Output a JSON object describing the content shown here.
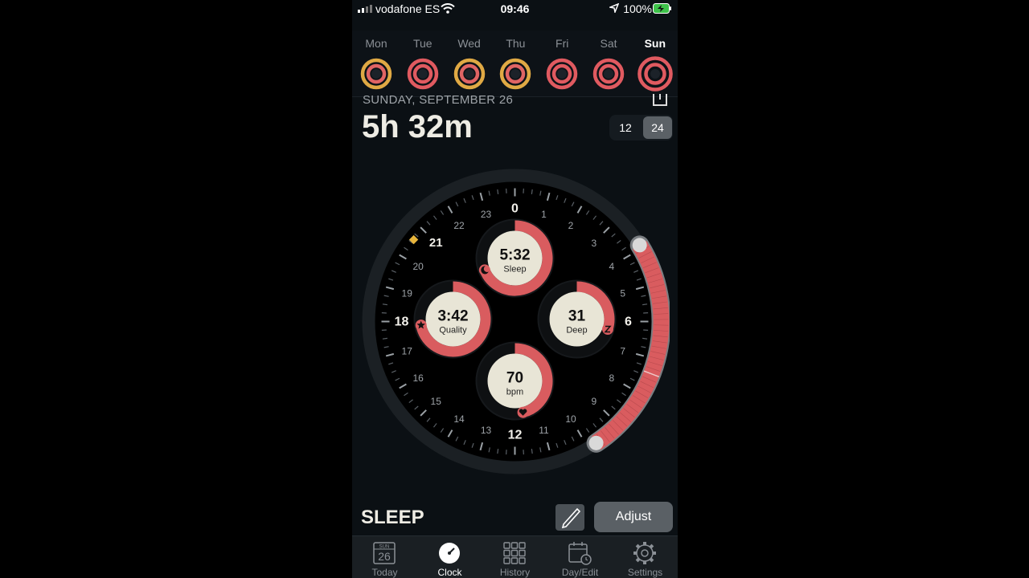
{
  "status": {
    "carrier": "vodafone ES",
    "time": "09:46",
    "battery": "100%"
  },
  "week": [
    {
      "label": "Mon",
      "outer_color": "#e0a944",
      "inner_color": "#e06464",
      "active": false
    },
    {
      "label": "Tue",
      "outer_color": "#e05a60",
      "inner_color": "#e05a60",
      "active": false
    },
    {
      "label": "Wed",
      "outer_color": "#e0a944",
      "inner_color": "#e06464",
      "active": false
    },
    {
      "label": "Thu",
      "outer_color": "#e0a944",
      "inner_color": "#e06464",
      "active": false
    },
    {
      "label": "Fri",
      "outer_color": "#e05a60",
      "inner_color": "#e05a60",
      "active": false
    },
    {
      "label": "Sat",
      "outer_color": "#e05a60",
      "inner_color": "#e05a60",
      "active": false
    },
    {
      "label": "Sun",
      "outer_color": "#e05a60",
      "inner_color": "#e05a60",
      "active": true
    }
  ],
  "header": {
    "date": "SUNDAY, SEPTEMBER 26",
    "duration": "5h 32m"
  },
  "time_format": {
    "opt12": "12",
    "opt24": "24",
    "selected": "24"
  },
  "clock": {
    "hours": [
      "0",
      "1",
      "2",
      "3",
      "4",
      "5",
      "6",
      "7",
      "8",
      "9",
      "10",
      "11",
      "12",
      "13",
      "14",
      "15",
      "16",
      "17",
      "18",
      "19",
      "20",
      "21",
      "22",
      "23"
    ],
    "highlighted_hour": "21",
    "sleep_arc": {
      "start_hour": 3.9,
      "end_hour": 9.75
    },
    "accent": "#d95c5f",
    "bedtime_marker_color": "#e7b53c"
  },
  "stats": {
    "sleep": {
      "value": "5:32",
      "label": "Sleep",
      "progress": 0.69,
      "icon": "moon-icon"
    },
    "quality": {
      "value": "3:42",
      "label": "Quality",
      "progress": 0.72,
      "icon": "star-icon"
    },
    "deep": {
      "value": "31",
      "label": "Deep",
      "progress": 0.3,
      "icon": "z-icon"
    },
    "heart": {
      "value": "70",
      "label": "bpm",
      "progress": 0.46,
      "icon": "heart-icon"
    }
  },
  "footer": {
    "title": "SLEEP",
    "adjust": "Adjust"
  },
  "tabs": [
    {
      "label": "Today",
      "icon": "calendar-today-icon",
      "badge_top": "SUN",
      "badge_num": "26",
      "active": false
    },
    {
      "label": "Clock",
      "icon": "clock-icon",
      "active": true
    },
    {
      "label": "History",
      "icon": "grid-icon",
      "active": false
    },
    {
      "label": "Day/Edit",
      "icon": "calendar-edit-icon",
      "active": false
    },
    {
      "label": "Settings",
      "icon": "gear-icon",
      "active": false
    }
  ]
}
